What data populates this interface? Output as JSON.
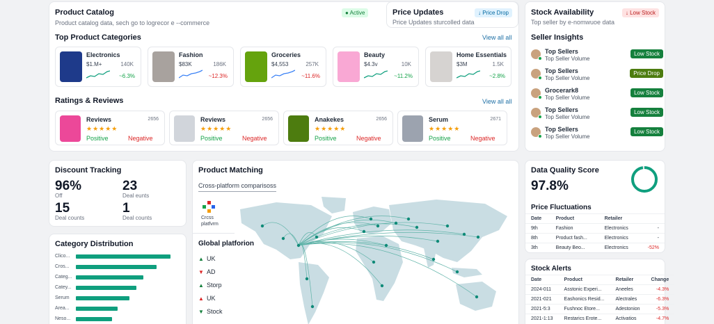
{
  "product_catalog": {
    "title": "Product Catalog",
    "subtitle": "Product catalog data, sech go to logrecor e --commerce",
    "badge": "Active"
  },
  "price_updates": {
    "title": "Price Updates",
    "subtitle": "Price Updates sturcolled data",
    "badge": "Price Drop"
  },
  "stock_availability": {
    "title": "Stock Availability",
    "subtitle": "Top seller by e-nomwuoe data",
    "badge": "Low Stock"
  },
  "top_categories": {
    "title": "Top Product Categories",
    "view_all": "View all all",
    "items": [
      {
        "name": "Electronics",
        "price": "$1.M+",
        "count": "140K",
        "change": "~6.3%",
        "trend": "up",
        "thumb_color": "#1e3a8a"
      },
      {
        "name": "Fashion",
        "price": "$83K",
        "count": "186K",
        "change": "~12.3%",
        "trend": "down",
        "thumb_color": "#a8a29e"
      },
      {
        "name": "Groceries",
        "price": "$4,553",
        "count": "257K",
        "change": "~11.6%",
        "trend": "down",
        "thumb_color": "#65a30d"
      },
      {
        "name": "Beauty",
        "price": "$4.3v",
        "count": "10K",
        "change": "~11.2%",
        "trend": "up",
        "thumb_color": "#f9a8d4"
      },
      {
        "name": "Home Essentials",
        "price": "$3M",
        "count": "1.5K",
        "change": "~2.8%",
        "trend": "up",
        "thumb_color": "#d6d3d1"
      }
    ]
  },
  "ratings_reviews": {
    "title": "Ratings & Reviews",
    "view_all": "View all all",
    "positive_label": "Positive",
    "negative_label": "Negative",
    "items": [
      {
        "name": "Reviews",
        "count": "2656",
        "stars": "★★★★★",
        "thumb_color": "#ec4899"
      },
      {
        "name": "Reviews",
        "count": "2656",
        "stars": "★★★★★",
        "thumb_color": "#d1d5db"
      },
      {
        "name": "Anakekes",
        "count": "2656",
        "stars": "★★★★★",
        "thumb_color": "#4d7c0f"
      },
      {
        "name": "Serum",
        "count": "2671",
        "stars": "★★★★★",
        "thumb_color": "#9ca3af"
      }
    ]
  },
  "seller_insights": {
    "title": "Seller Insights",
    "items": [
      {
        "name": "Top Sellers",
        "detail": "Top Seller Volume",
        "badge": "Low Stock",
        "badge_style": "b-dg"
      },
      {
        "name": "Top Sellers",
        "detail": "Top Seller Volume",
        "badge": "Price Drop",
        "badge_style": "b-ol"
      },
      {
        "name": "Grocerark8",
        "detail": "Top Seller Volume",
        "badge": "Low Stock",
        "badge_style": "b-dg"
      },
      {
        "name": "Top Sellers",
        "detail": "Top Seller Volume",
        "badge": "Low Stock",
        "badge_style": "b-dg"
      },
      {
        "name": "Top Sellers",
        "detail": "Top Seller Volume",
        "badge": "Low Stock",
        "badge_style": "b-dg"
      }
    ]
  },
  "discount_tracking": {
    "title": "Discount Tracking",
    "metrics": [
      {
        "value": "96%",
        "label": "Off"
      },
      {
        "value": "23",
        "label": "Deal eunts"
      },
      {
        "value": "15",
        "label": "Deal counts"
      },
      {
        "value": "1",
        "label": "Deal counts"
      }
    ]
  },
  "category_distribution": {
    "title": "Category Distribution",
    "bars": [
      {
        "label": "Clico...",
        "value": 0.97
      },
      {
        "label": "Cros...",
        "value": 0.83
      },
      {
        "label": "Categ...",
        "value": 0.69
      },
      {
        "label": "Catey...",
        "value": 0.62
      },
      {
        "label": "Serum",
        "value": 0.55
      },
      {
        "label": "Area...",
        "value": 0.43
      },
      {
        "label": "Neso...",
        "value": 0.37
      }
    ]
  },
  "product_matching": {
    "title": "Product Matching",
    "tab": "Cross-platform comparisoss",
    "logo_text": "Crcss platfvrm",
    "global_title": "Global platforion",
    "platforms": [
      {
        "label": "UK",
        "dir": "up"
      },
      {
        "label": "AD",
        "dir": "down"
      },
      {
        "label": "Storp",
        "dir": "up"
      },
      {
        "label": "UK",
        "dir": "up-red"
      },
      {
        "label": "Stock",
        "dir": "down-green"
      }
    ]
  },
  "data_quality": {
    "title": "Data Quality Score",
    "score": "97.8%",
    "ring_fraction": 0.978
  },
  "price_fluctuations": {
    "title": "Price Fluctuations",
    "headers": [
      "Date",
      "Product",
      "Retailer",
      ""
    ],
    "rows": [
      [
        "9th",
        "Fashion",
        "Electronics",
        "-"
      ],
      [
        "8th",
        "Product fash...",
        "Electronics",
        "-"
      ],
      [
        "3th",
        "Beauty Beo...",
        "Electronics",
        "-52%"
      ]
    ]
  },
  "stock_alerts": {
    "title": "Stock Alerts",
    "headers": [
      "Date",
      "Product",
      "Retailer",
      "Change"
    ],
    "rows": [
      [
        "2024-011",
        "Asstonic Experi...",
        "Aneeles",
        "-4.3%"
      ],
      [
        "2021-021",
        "Eashonics Resid...",
        "Alectrales",
        "-6.3%"
      ],
      [
        "2021-5:3",
        "Fushnoc Etore...",
        "Adestonion",
        "-5.3%"
      ],
      [
        "2021-1:13",
        "Restarics Erote...",
        "Activatios",
        "-4.7%"
      ]
    ]
  },
  "colors": {
    "accent": "#0f9f7e",
    "link": "#1d6fa5",
    "positive": "#16a34a",
    "negative": "#dc2626"
  }
}
